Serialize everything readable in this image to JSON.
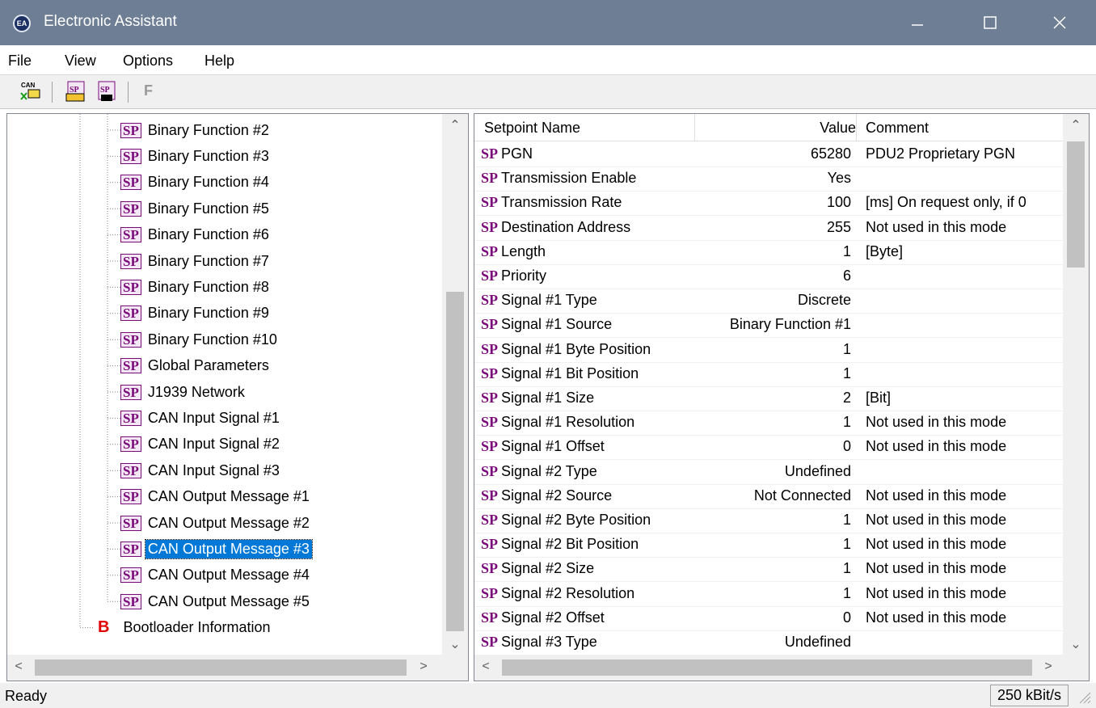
{
  "window": {
    "title": "Electronic Assistant",
    "icon": "ea-app-icon"
  },
  "menu": [
    "File",
    "View",
    "Options",
    "Help"
  ],
  "toolbar": {
    "icons": [
      "can-connect-icon",
      "open-setpoint-file-icon",
      "save-setpoint-file-icon",
      "flash-icon"
    ],
    "flash_label": "F"
  },
  "tree": {
    "badge": "SP",
    "items": [
      "Binary Function #2",
      "Binary Function #3",
      "Binary Function #4",
      "Binary Function #5",
      "Binary Function #6",
      "Binary Function #7",
      "Binary Function #8",
      "Binary Function #9",
      "Binary Function #10",
      "Global Parameters",
      "J1939 Network",
      "CAN Input Signal #1",
      "CAN Input Signal #2",
      "CAN Input Signal #3",
      "CAN Output Message #1",
      "CAN Output Message #2",
      "CAN Output Message #3",
      "CAN Output Message #4",
      "CAN Output Message #5"
    ],
    "selected_index": 16,
    "bootloader": {
      "badge": "B",
      "label": "Bootloader Information"
    }
  },
  "grid": {
    "columns": [
      "Setpoint Name",
      "Value",
      "Comment"
    ],
    "rows": [
      {
        "name": "PGN",
        "value": "65280",
        "comment": "PDU2 Proprietary PGN"
      },
      {
        "name": "Transmission Enable",
        "value": "Yes",
        "comment": ""
      },
      {
        "name": "Transmission Rate",
        "value": "100",
        "comment": "[ms]  On request only, if 0"
      },
      {
        "name": "Destination Address",
        "value": "255",
        "comment": "Not used in this mode"
      },
      {
        "name": "Length",
        "value": "1",
        "comment": "[Byte]"
      },
      {
        "name": "Priority",
        "value": "6",
        "comment": ""
      },
      {
        "name": "Signal #1 Type",
        "value": "Discrete",
        "comment": ""
      },
      {
        "name": "Signal #1 Source",
        "value": "Binary Function #1",
        "comment": ""
      },
      {
        "name": "Signal #1 Byte Position",
        "value": "1",
        "comment": ""
      },
      {
        "name": "Signal #1 Bit Position",
        "value": "1",
        "comment": ""
      },
      {
        "name": "Signal #1 Size",
        "value": "2",
        "comment": "[Bit]"
      },
      {
        "name": "Signal #1 Resolution",
        "value": "1",
        "comment": "Not used in this mode"
      },
      {
        "name": "Signal #1 Offset",
        "value": "0",
        "comment": "Not used in this mode"
      },
      {
        "name": "Signal #2 Type",
        "value": "Undefined",
        "comment": ""
      },
      {
        "name": "Signal #2 Source",
        "value": "Not Connected",
        "comment": "Not used in this mode"
      },
      {
        "name": "Signal #2 Byte Position",
        "value": "1",
        "comment": "Not used in this mode"
      },
      {
        "name": "Signal #2 Bit Position",
        "value": "1",
        "comment": "Not used in this mode"
      },
      {
        "name": "Signal #2 Size",
        "value": "1",
        "comment": "Not used in this mode"
      },
      {
        "name": "Signal #2 Resolution",
        "value": "1",
        "comment": "Not used in this mode"
      },
      {
        "name": "Signal #2 Offset",
        "value": "0",
        "comment": "Not used in this mode"
      },
      {
        "name": "Signal #3 Type",
        "value": "Undefined",
        "comment": ""
      }
    ]
  },
  "status": {
    "text": "Ready",
    "baud": "250 kBit/s"
  }
}
